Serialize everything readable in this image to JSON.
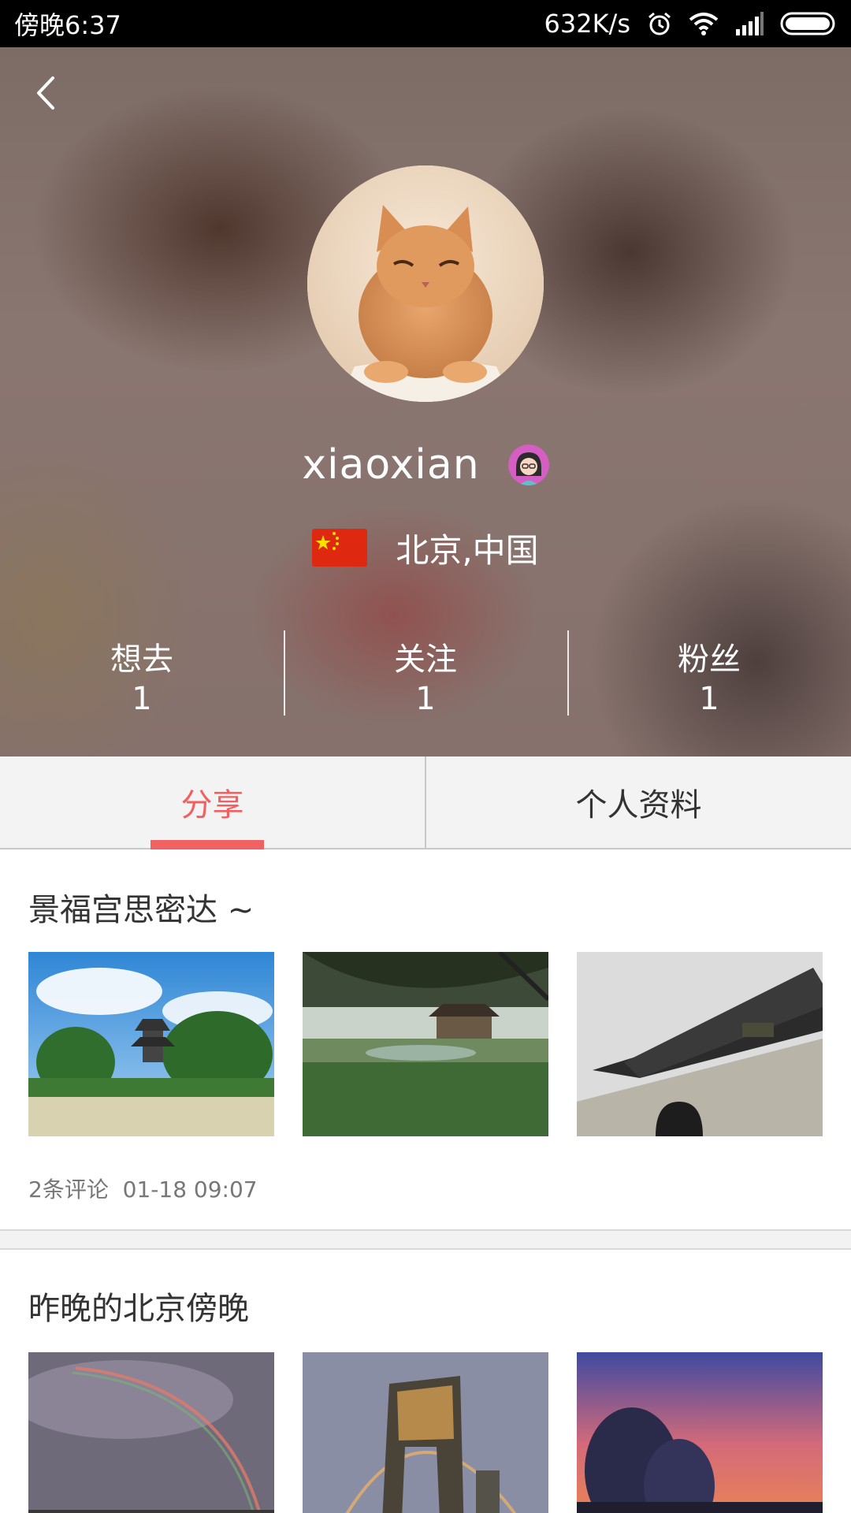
{
  "status_bar": {
    "time": "傍晚6:37",
    "network_speed": "632K/s",
    "icons": [
      "alarm-icon",
      "wifi-icon",
      "signal-icon",
      "battery-icon"
    ]
  },
  "profile": {
    "username": "xiaoxian",
    "location": "北京,中国",
    "stats": [
      {
        "label": "想去",
        "value": "1"
      },
      {
        "label": "关注",
        "value": "1"
      },
      {
        "label": "粉丝",
        "value": "1"
      }
    ]
  },
  "tabs": [
    {
      "label": "分享",
      "active": true
    },
    {
      "label": "个人资料",
      "active": false
    }
  ],
  "posts": [
    {
      "title": "景福宫思密达 ~",
      "comments": "2条评论",
      "datetime": "01-18 09:07"
    },
    {
      "title": "昨晚的北京傍晚",
      "comments": "",
      "datetime": ""
    }
  ],
  "colors": {
    "accent": "#f06262",
    "status_bar": "#000000",
    "tab_bg": "#f3f3f3"
  }
}
